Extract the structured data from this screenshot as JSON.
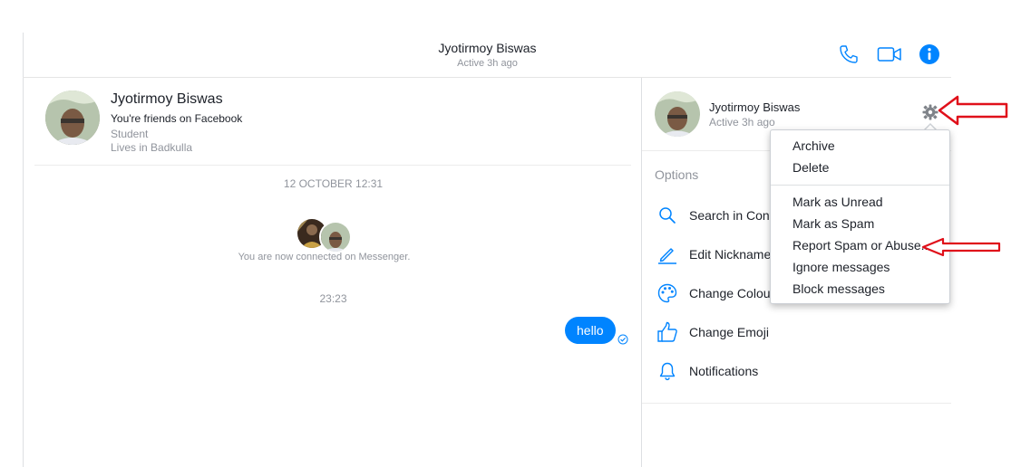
{
  "header": {
    "name": "Jyotirmoy Biswas",
    "status": "Active 3h ago"
  },
  "profile": {
    "name": "Jyotirmoy Biswas",
    "friends": "You're friends on Facebook",
    "occupation": "Student",
    "location": "Lives in Badkulla"
  },
  "conversation": {
    "date_divider": "12 OCTOBER 12:31",
    "connected_text": "You are now connected on Messenger.",
    "time_divider": "23:23",
    "message": "hello"
  },
  "sidebar": {
    "name": "Jyotirmoy Biswas",
    "status": "Active 3h ago",
    "options_title": "Options",
    "options": [
      {
        "label": "Search in Conversation",
        "icon": "search-icon"
      },
      {
        "label": "Edit Nicknames",
        "icon": "pencil-icon"
      },
      {
        "label": "Change Colour",
        "icon": "palette-icon"
      },
      {
        "label": "Change Emoji",
        "icon": "thumbs-up-icon"
      },
      {
        "label": "Notifications",
        "icon": "bell-icon"
      }
    ]
  },
  "dropdown": {
    "items": [
      "Archive",
      "Delete",
      "Mark as Unread",
      "Mark as Spam",
      "Report Spam or Abuse...",
      "Ignore messages",
      "Block messages"
    ]
  },
  "colors": {
    "accent": "#0084ff",
    "annotation": "#e0101a"
  }
}
